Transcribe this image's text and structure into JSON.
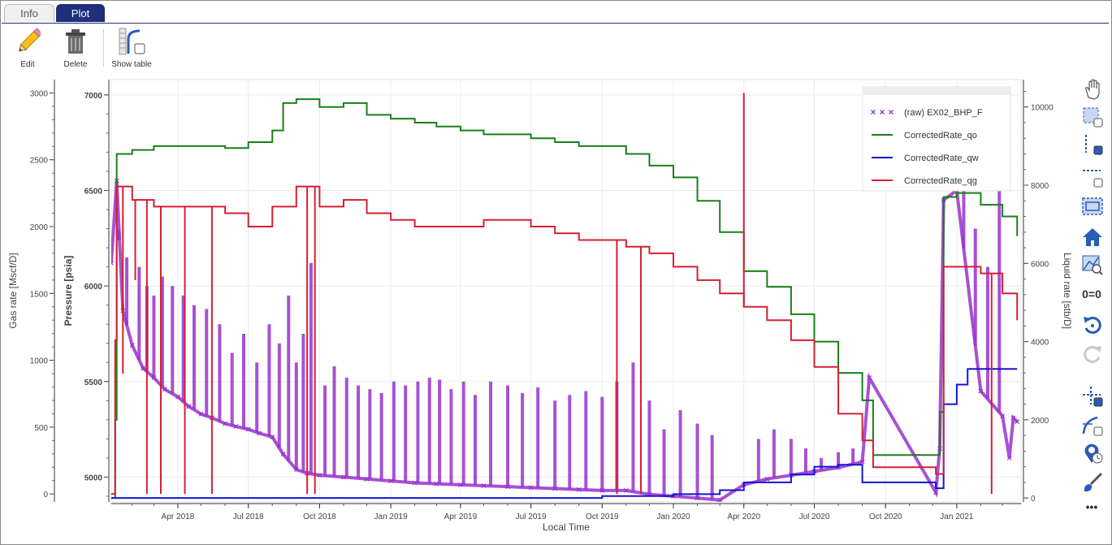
{
  "tabs": [
    {
      "label": "Info",
      "active": false
    },
    {
      "label": "Plot",
      "active": true
    }
  ],
  "toolbar": {
    "edit_label": "Edit",
    "delete_label": "Delete",
    "show_table_label": "Show table"
  },
  "colors": {
    "raw": "#9932cc",
    "qo": "#1a7f1a",
    "qw": "#1414d2",
    "qg": "#d42031",
    "tab_active": "#1f2f7a"
  },
  "right_toolbar": {
    "icons": [
      "pan-icon",
      "box-select-icon",
      "y-select-icon",
      "x-select-icon",
      "box-zoom-icon",
      "home-icon",
      "zoom-to-fit-icon",
      "zero-zero-icon",
      "undo-icon",
      "redo-icon",
      "crosshair-icon",
      "hover-line-icon",
      "hover-tooltip-icon",
      "brush-icon",
      "more-icon"
    ],
    "zero_label": "0=0",
    "more_label": "•••"
  },
  "chart_data": {
    "type": "line",
    "xlabel": "Local Time",
    "ylabel_left_outer": "Gas rate [Mscf/D]",
    "ylabel_left_inner": "Pressure [psia]",
    "ylabel_right": "Liquid rate [stb/D]",
    "x_ticks": [
      "Apr 2018",
      "Jul 2018",
      "Oct 2018",
      "Jan 2019",
      "Apr 2019",
      "Jul 2019",
      "Oct 2019",
      "Jan 2020",
      "Apr 2020",
      "Jul 2020",
      "Oct 2020",
      "Jan 2021"
    ],
    "x_range": [
      "2018-01-05",
      "2021-03-25"
    ],
    "gas_axis": {
      "ticks": [
        0,
        500,
        1000,
        1500,
        2000,
        2500,
        3000
      ],
      "range": [
        -60,
        3100
      ]
    },
    "pressure_axis": {
      "ticks": [
        5000,
        5500,
        6000,
        6500,
        7000
      ],
      "range": [
        4870,
        7080
      ]
    },
    "liquid_axis": {
      "ticks": [
        0,
        2000,
        4000,
        6000,
        8000,
        10000
      ],
      "range": [
        -100,
        10700
      ]
    },
    "legend": {
      "placement": "top-right",
      "entries": [
        "(raw) EX02_BHP_F",
        "CorrectedRate_qo",
        "CorrectedRate_qw",
        "CorrectedRate_qg"
      ]
    },
    "series": [
      {
        "name": "(raw) EX02_BHP_F",
        "axis": "pressure",
        "style": "x-markers",
        "points": [
          [
            "2018-01-05",
            6120
          ],
          [
            "2018-01-12",
            6550
          ],
          [
            "2018-01-20",
            5870
          ],
          [
            "2018-02-01",
            5690
          ],
          [
            "2018-02-15",
            5570
          ],
          [
            "2018-03-01",
            5520
          ],
          [
            "2018-03-15",
            5460
          ],
          [
            "2018-04-01",
            5420
          ],
          [
            "2018-04-15",
            5370
          ],
          [
            "2018-05-01",
            5330
          ],
          [
            "2018-05-15",
            5310
          ],
          [
            "2018-06-01",
            5280
          ],
          [
            "2018-06-15",
            5265
          ],
          [
            "2018-07-01",
            5250
          ],
          [
            "2018-07-15",
            5230
          ],
          [
            "2018-08-01",
            5210
          ],
          [
            "2018-08-15",
            5120
          ],
          [
            "2018-09-01",
            5040
          ],
          [
            "2018-09-15",
            5020
          ],
          [
            "2018-10-01",
            5010
          ],
          [
            "2018-11-01",
            5000
          ],
          [
            "2018-12-01",
            4990
          ],
          [
            "2019-01-01",
            4980
          ],
          [
            "2019-02-01",
            4970
          ],
          [
            "2019-03-01",
            4965
          ],
          [
            "2019-04-01",
            4960
          ],
          [
            "2019-05-01",
            4955
          ],
          [
            "2019-06-01",
            4950
          ],
          [
            "2019-07-01",
            4945
          ],
          [
            "2019-08-01",
            4940
          ],
          [
            "2019-09-01",
            4935
          ],
          [
            "2019-10-01",
            4930
          ],
          [
            "2019-11-01",
            4930
          ],
          [
            "2019-12-01",
            4910
          ],
          [
            "2020-01-01",
            4900
          ],
          [
            "2020-02-01",
            4890
          ],
          [
            "2020-03-01",
            4880
          ],
          [
            "2020-04-01",
            4960
          ],
          [
            "2020-05-01",
            4990
          ],
          [
            "2020-06-01",
            5010
          ],
          [
            "2020-07-01",
            5030
          ],
          [
            "2020-08-01",
            5050
          ],
          [
            "2020-09-01",
            5080
          ],
          [
            "2020-09-10",
            5520
          ],
          [
            "2020-12-05",
            4920
          ],
          [
            "2020-12-10",
            5150
          ],
          [
            "2020-12-15",
            6450
          ],
          [
            "2021-01-01",
            6500
          ],
          [
            "2021-02-01",
            5450
          ],
          [
            "2021-03-01",
            5320
          ],
          [
            "2021-03-10",
            5100
          ],
          [
            "2021-03-15",
            5310
          ],
          [
            "2021-03-20",
            5290
          ]
        ],
        "spikes": [
          [
            "2018-01-15",
            6240
          ],
          [
            "2018-01-25",
            6150
          ],
          [
            "2018-02-10",
            6100
          ],
          [
            "2018-02-20",
            6000
          ],
          [
            "2018-03-01",
            5950
          ],
          [
            "2018-03-12",
            6050
          ],
          [
            "2018-03-25",
            6000
          ],
          [
            "2018-04-08",
            5950
          ],
          [
            "2018-04-22",
            5900
          ],
          [
            "2018-05-08",
            5880
          ],
          [
            "2018-05-25",
            5800
          ],
          [
            "2018-06-10",
            5650
          ],
          [
            "2018-06-25",
            5750
          ],
          [
            "2018-07-12",
            5600
          ],
          [
            "2018-07-28",
            5800
          ],
          [
            "2018-08-10",
            5700
          ],
          [
            "2018-08-22",
            5950
          ],
          [
            "2018-09-01",
            5600
          ],
          [
            "2018-09-10",
            5750
          ],
          [
            "2018-09-20",
            6120
          ],
          [
            "2018-10-08",
            5480
          ],
          [
            "2018-10-20",
            5580
          ],
          [
            "2018-11-05",
            5520
          ],
          [
            "2018-11-20",
            5480
          ],
          [
            "2018-12-05",
            5460
          ],
          [
            "2018-12-20",
            5440
          ],
          [
            "2019-01-05",
            5500
          ],
          [
            "2019-01-20",
            5480
          ],
          [
            "2019-02-05",
            5500
          ],
          [
            "2019-02-20",
            5520
          ],
          [
            "2019-03-05",
            5510
          ],
          [
            "2019-03-20",
            5460
          ],
          [
            "2019-04-05",
            5500
          ],
          [
            "2019-04-20",
            5430
          ],
          [
            "2019-05-10",
            5500
          ],
          [
            "2019-06-01",
            5480
          ],
          [
            "2019-06-20",
            5440
          ],
          [
            "2019-07-10",
            5470
          ],
          [
            "2019-08-01",
            5400
          ],
          [
            "2019-08-20",
            5430
          ],
          [
            "2019-09-10",
            5450
          ],
          [
            "2019-10-01",
            5420
          ],
          [
            "2019-10-20",
            5500
          ],
          [
            "2019-11-10",
            5600
          ],
          [
            "2019-12-01",
            5400
          ],
          [
            "2019-12-20",
            5250
          ],
          [
            "2020-01-10",
            5350
          ],
          [
            "2020-02-01",
            5280
          ],
          [
            "2020-02-20",
            5220
          ],
          [
            "2020-04-20",
            5200
          ],
          [
            "2020-05-10",
            5250
          ],
          [
            "2020-06-01",
            5200
          ],
          [
            "2020-06-20",
            5150
          ],
          [
            "2020-07-10",
            5100
          ],
          [
            "2020-08-01",
            5130
          ],
          [
            "2020-08-20",
            5150
          ],
          [
            "2021-01-10",
            6500
          ],
          [
            "2021-01-25",
            6300
          ],
          [
            "2021-02-10",
            6100
          ],
          [
            "2021-02-25",
            6500
          ]
        ]
      },
      {
        "name": "CorrectedRate_qo",
        "axis": "liquid",
        "style": "step-line",
        "points": [
          [
            "2018-01-05",
            0
          ],
          [
            "2018-01-10",
            2000
          ],
          [
            "2018-01-12",
            8800
          ],
          [
            "2018-02-01",
            8900
          ],
          [
            "2018-03-01",
            9000
          ],
          [
            "2018-04-01",
            9000
          ],
          [
            "2018-05-01",
            9000
          ],
          [
            "2018-06-01",
            8950
          ],
          [
            "2018-07-01",
            9100
          ],
          [
            "2018-08-01",
            9400
          ],
          [
            "2018-08-15",
            10100
          ],
          [
            "2018-09-01",
            10200
          ],
          [
            "2018-10-01",
            10000
          ],
          [
            "2018-11-01",
            10100
          ],
          [
            "2018-12-01",
            9800
          ],
          [
            "2019-01-01",
            9700
          ],
          [
            "2019-02-01",
            9600
          ],
          [
            "2019-03-01",
            9500
          ],
          [
            "2019-04-01",
            9400
          ],
          [
            "2019-05-01",
            9300
          ],
          [
            "2019-06-01",
            9300
          ],
          [
            "2019-07-01",
            9200
          ],
          [
            "2019-08-01",
            9100
          ],
          [
            "2019-09-01",
            9000
          ],
          [
            "2019-10-01",
            9000
          ],
          [
            "2019-11-01",
            8800
          ],
          [
            "2019-12-01",
            8500
          ],
          [
            "2020-01-01",
            8200
          ],
          [
            "2020-02-01",
            7600
          ],
          [
            "2020-03-01",
            6800
          ],
          [
            "2020-04-01",
            5800
          ],
          [
            "2020-05-01",
            5400
          ],
          [
            "2020-06-01",
            4700
          ],
          [
            "2020-07-01",
            4000
          ],
          [
            "2020-08-01",
            3200
          ],
          [
            "2020-09-01",
            2500
          ],
          [
            "2020-09-15",
            1100
          ],
          [
            "2020-12-05",
            1100
          ],
          [
            "2020-12-10",
            2200
          ],
          [
            "2020-12-15",
            7700
          ],
          [
            "2021-01-01",
            7800
          ],
          [
            "2021-02-01",
            7500
          ],
          [
            "2021-03-01",
            7200
          ],
          [
            "2021-03-20",
            6700
          ]
        ]
      },
      {
        "name": "CorrectedRate_qw",
        "axis": "liquid",
        "style": "step-line",
        "points": [
          [
            "2018-01-05",
            0
          ],
          [
            "2019-01-01",
            0
          ],
          [
            "2019-10-01",
            50
          ],
          [
            "2020-01-01",
            100
          ],
          [
            "2020-03-01",
            200
          ],
          [
            "2020-04-01",
            400
          ],
          [
            "2020-06-01",
            600
          ],
          [
            "2020-07-01",
            800
          ],
          [
            "2020-08-01",
            850
          ],
          [
            "2020-09-01",
            400
          ],
          [
            "2020-12-05",
            250
          ],
          [
            "2020-12-15",
            2400
          ],
          [
            "2021-01-01",
            2900
          ],
          [
            "2021-01-15",
            3300
          ],
          [
            "2021-03-20",
            3300
          ]
        ]
      },
      {
        "name": "CorrectedRate_qg",
        "axis": "gas",
        "style": "step-line",
        "points": [
          [
            "2018-01-05",
            0
          ],
          [
            "2018-01-10",
            1150
          ],
          [
            "2018-01-12",
            2300
          ],
          [
            "2018-02-01",
            2200
          ],
          [
            "2018-03-01",
            2150
          ],
          [
            "2018-04-01",
            2150
          ],
          [
            "2018-05-01",
            2150
          ],
          [
            "2018-06-01",
            2100
          ],
          [
            "2018-07-01",
            2000
          ],
          [
            "2018-08-01",
            2150
          ],
          [
            "2018-09-01",
            2300
          ],
          [
            "2018-10-01",
            2150
          ],
          [
            "2018-11-01",
            2200
          ],
          [
            "2018-12-01",
            2100
          ],
          [
            "2019-01-01",
            2050
          ],
          [
            "2019-02-01",
            2000
          ],
          [
            "2019-03-01",
            2000
          ],
          [
            "2019-04-01",
            2000
          ],
          [
            "2019-05-01",
            2050
          ],
          [
            "2019-06-01",
            2050
          ],
          [
            "2019-07-01",
            2000
          ],
          [
            "2019-08-01",
            1950
          ],
          [
            "2019-09-01",
            1900
          ],
          [
            "2019-10-01",
            1900
          ],
          [
            "2019-11-01",
            1850
          ],
          [
            "2019-12-01",
            1800
          ],
          [
            "2020-01-01",
            1700
          ],
          [
            "2020-02-01",
            1600
          ],
          [
            "2020-03-01",
            1500
          ],
          [
            "2020-04-01",
            1400
          ],
          [
            "2020-05-01",
            1300
          ],
          [
            "2020-06-01",
            1150
          ],
          [
            "2020-07-01",
            950
          ],
          [
            "2020-08-01",
            600
          ],
          [
            "2020-09-01",
            400
          ],
          [
            "2020-09-15",
            200
          ],
          [
            "2020-12-05",
            150
          ],
          [
            "2020-12-15",
            1700
          ],
          [
            "2021-01-01",
            1700
          ],
          [
            "2021-02-01",
            1650
          ],
          [
            "2021-03-01",
            1500
          ],
          [
            "2021-03-20",
            1300
          ]
        ],
        "spikes": [
          [
            "2018-01-20",
            900
          ],
          [
            "2018-02-05",
            1600
          ],
          [
            "2018-02-20",
            0
          ],
          [
            "2018-03-10",
            0
          ],
          [
            "2018-04-10",
            0
          ],
          [
            "2018-05-15",
            0
          ],
          [
            "2018-09-15",
            0
          ],
          [
            "2018-09-25",
            0
          ],
          [
            "2019-10-20",
            0
          ],
          [
            "2019-11-20",
            0
          ],
          [
            "2020-04-01",
            3000
          ],
          [
            "2021-02-15",
            0
          ]
        ]
      }
    ]
  }
}
